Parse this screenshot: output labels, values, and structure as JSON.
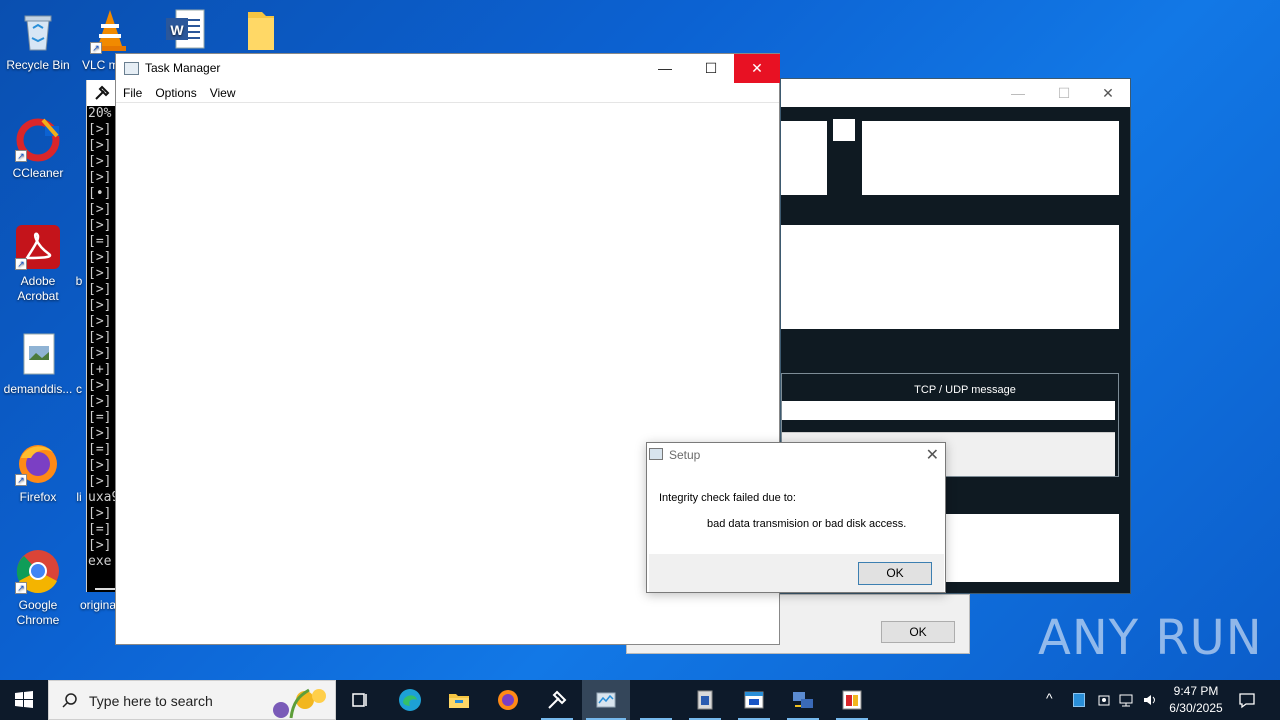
{
  "desktop": {
    "icons": [
      {
        "label": "Recycle Bin",
        "icon": "recycle-bin-icon"
      },
      {
        "label": "VLC m",
        "icon": "vlc-icon"
      },
      {
        "label": "",
        "icon": "word-icon"
      },
      {
        "label": "",
        "icon": "folder-icon"
      },
      {
        "label": "CCleaner",
        "icon": "ccleaner-icon"
      },
      {
        "label": "Adobe Acrobat",
        "icon": "acrobat-icon"
      },
      {
        "label": "b",
        "icon": "partial-icon"
      },
      {
        "label": "demanddis...",
        "icon": "image-file-icon"
      },
      {
        "label": "c",
        "icon": "partial-icon"
      },
      {
        "label": "Firefox",
        "icon": "firefox-icon"
      },
      {
        "label": "li",
        "icon": "partial-icon"
      },
      {
        "label": "Google Chrome",
        "icon": "chrome-icon"
      },
      {
        "label": "origina",
        "icon": "partial-icon"
      }
    ]
  },
  "console": {
    "lines": "20%\n[>]\n[>]\n[>]\n[>]\n[•]\n[>]\n[>]\n[=]\n[>]\n[>]\n[>]\n[>]\n[>]\n[>]\n[>]\n[+]\n[>]\n[>]\n[=]\n[>]\n[=]\n[>]\n[>]\nuxa9\n[>]\n[=]\n[>]\nexe"
  },
  "app_window": {
    "tcp_udp_label": "TCP / UDP message",
    "ok_label": "OK"
  },
  "task_manager": {
    "title": "Task Manager",
    "menu": {
      "file": "File",
      "options": "Options",
      "view": "View"
    }
  },
  "setup_dialog": {
    "title": "Setup",
    "line1": "Integrity check failed due to:",
    "line2": "bad data transmision or bad disk access.",
    "ok_label": "OK"
  },
  "taskbar": {
    "search_placeholder": "Type here to search",
    "time": "9:47 PM",
    "date": "6/30/2025"
  },
  "watermark": "ANY RUN",
  "colors": {
    "desktop_blue": "#0c62d2",
    "close_red": "#e81123",
    "taskbar": "#0d1a2a",
    "active_indicator": "#76b9ed"
  }
}
